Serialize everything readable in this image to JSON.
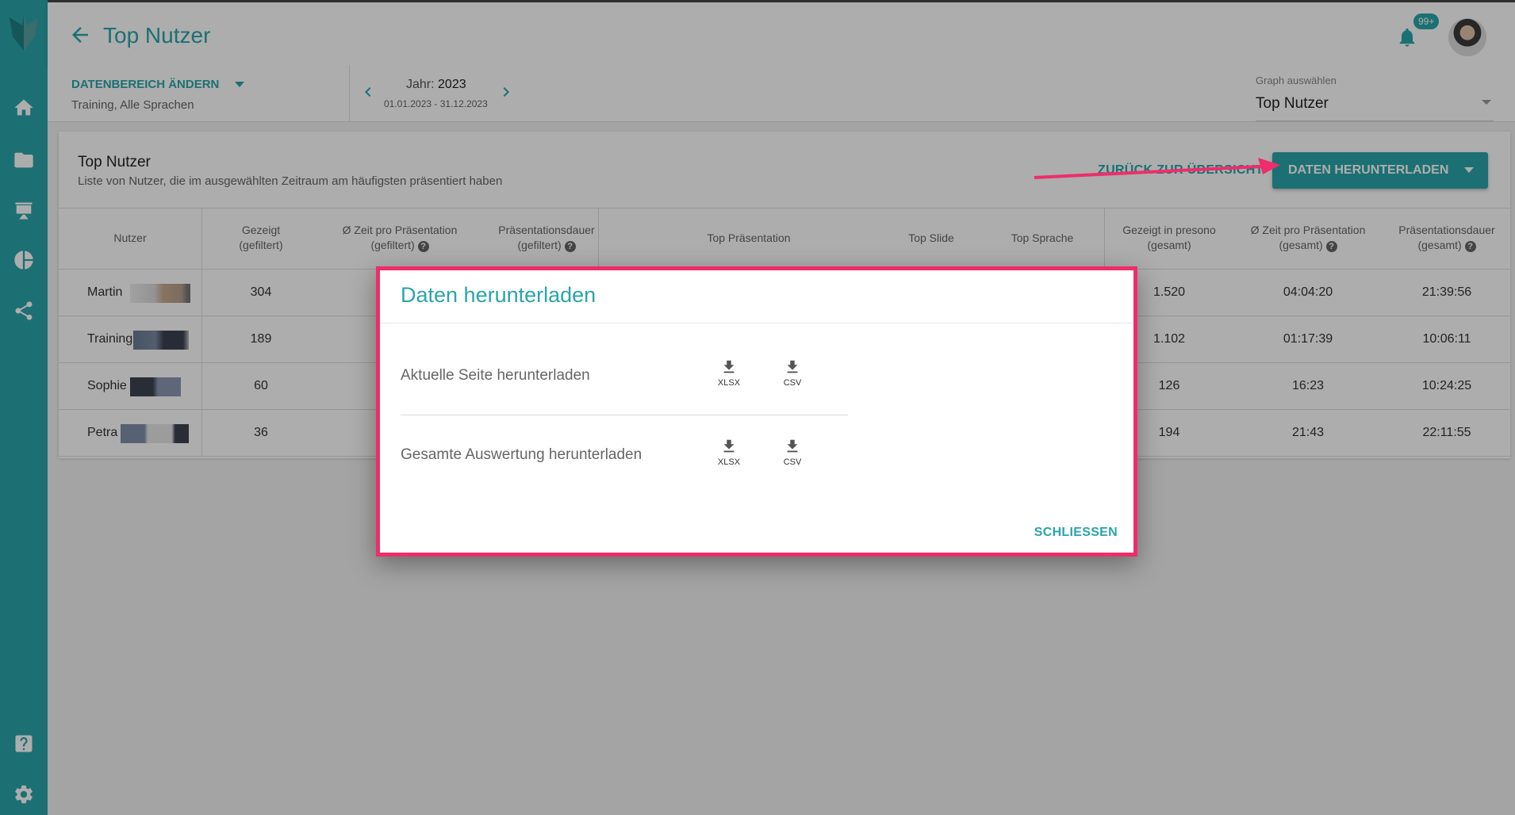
{
  "header": {
    "title": "Top Nutzer",
    "notifications_badge": "99+"
  },
  "filters": {
    "range_label": "DATENBEREICH ÄNDERN",
    "range_sub": "Training, Alle Sprachen",
    "year_label": "Jahr:",
    "year_value": "2023",
    "date_range": "01.01.2023 - 31.12.2023",
    "graph_label": "Graph auswählen",
    "graph_value": "Top Nutzer"
  },
  "card": {
    "title": "Top Nutzer",
    "subtitle": "Liste von Nutzer, die im ausgewählten Zeitraum am häufigsten präsentiert haben",
    "back_label": "ZURÜCK ZUR ÜBERSICHT",
    "download_label": "DATEN HERUNTERLADEN"
  },
  "table": {
    "columns": [
      {
        "l1": "Nutzer",
        "l2": ""
      },
      {
        "l1": "Gezeigt",
        "l2": "(gefiltert)"
      },
      {
        "l1": "Ø Zeit pro Präsentation",
        "l2": "(gefiltert)"
      },
      {
        "l1": "Präsentationsdauer",
        "l2": "(gefiltert)"
      },
      {
        "l1": "Top Präsentation",
        "l2": ""
      },
      {
        "l1": "Top Slide",
        "l2": ""
      },
      {
        "l1": "Top Sprache",
        "l2": ""
      },
      {
        "l1": "Gezeigt in presono",
        "l2": "(gesamt)"
      },
      {
        "l1": "Ø Zeit pro Präsentation",
        "l2": "(gesamt)"
      },
      {
        "l1": "Präsentationsdauer",
        "l2": "(gesamt)"
      }
    ],
    "rows": [
      {
        "name": "Martin",
        "shown": "304",
        "total_shown": "1.520",
        "avg_total": "04:04:20",
        "duration_total": "21:39:56"
      },
      {
        "name": "Training",
        "shown": "189",
        "total_shown": "1.102",
        "avg_total": "01:17:39",
        "duration_total": "10:06:11"
      },
      {
        "name": "Sophie",
        "shown": "60",
        "total_shown": "126",
        "avg_total": "16:23",
        "duration_total": "10:24:25"
      },
      {
        "name": "Petra",
        "shown": "36",
        "total_shown": "194",
        "avg_total": "21:43",
        "duration_total": "22:11:55"
      }
    ]
  },
  "dialog": {
    "title": "Daten herunterladen",
    "row1_label": "Aktuelle Seite herunterladen",
    "row2_label": "Gesamte Auswertung herunterladen",
    "xlsx": "XLSX",
    "csv": "CSV",
    "close_label": "SCHLIESSEN"
  },
  "colors": {
    "accent": "#2aa5aa",
    "highlight": "#ee2d6a"
  }
}
